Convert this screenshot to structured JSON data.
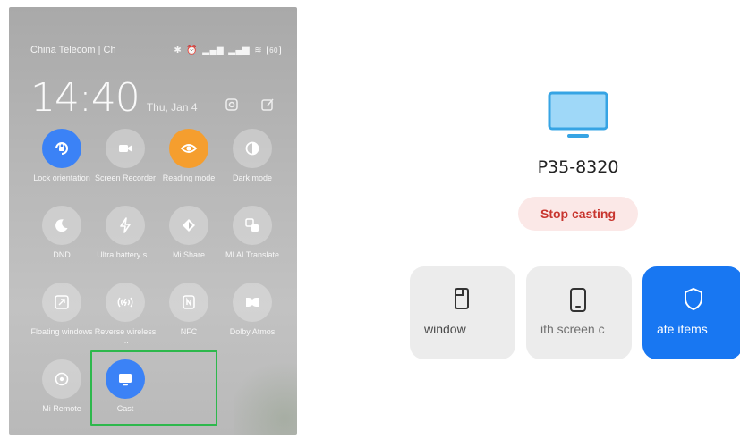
{
  "status_bar": {
    "carrier": "China Telecom | Ch",
    "icons": [
      "bluetooth-icon",
      "alarm-icon",
      "signal-icon",
      "signal-icon",
      "wifi-icon"
    ],
    "battery": "60"
  },
  "header": {
    "time": "14:40",
    "date": "Thu, Jan 4"
  },
  "tiles": [
    {
      "label": "Lock orientation",
      "icon": "lock-rotation-icon",
      "state": "active"
    },
    {
      "label": "Screen Recorder",
      "icon": "video-camera-icon",
      "state": "off"
    },
    {
      "label": "Reading mode",
      "icon": "eye-icon",
      "state": "active"
    },
    {
      "label": "Dark mode",
      "icon": "contrast-icon",
      "state": "off"
    },
    {
      "label": "DND",
      "icon": "moon-icon",
      "state": "off"
    },
    {
      "label": "Ultra battery s...",
      "icon": "lightning-icon",
      "state": "off"
    },
    {
      "label": "Mi Share",
      "icon": "mi-share-icon",
      "state": "off"
    },
    {
      "label": "MI AI Translate",
      "icon": "translate-icon",
      "state": "off"
    },
    {
      "label": "Floating windows",
      "icon": "floating-window-icon",
      "state": "off"
    },
    {
      "label": "Reverse wireless ...",
      "icon": "wireless-charging-icon",
      "state": "off"
    },
    {
      "label": "NFC",
      "icon": "nfc-icon",
      "state": "off"
    },
    {
      "label": "Dolby Atmos",
      "icon": "dolby-icon",
      "state": "off"
    },
    {
      "label": "Mi Remote",
      "icon": "remote-icon",
      "state": "off"
    },
    {
      "label": "Cast",
      "icon": "cast-icon",
      "state": "active"
    }
  ],
  "cast_panel": {
    "device_name": "P35-8320",
    "stop_label": "Stop casting",
    "actions": [
      {
        "label": "window",
        "icon": "window-icon"
      },
      {
        "label": "ith screen c",
        "icon": "phone-screen-icon"
      },
      {
        "label": "ate items",
        "icon": "shield-icon"
      }
    ]
  },
  "colors": {
    "active_blue": "#3b82f6",
    "active_orange": "#f59e2e",
    "highlight_green": "#2db84c",
    "stop_text": "#c8352e",
    "stop_bg": "#fbe8e7",
    "action_blue": "#1877f2",
    "monitor_blue": "#36a4e4"
  }
}
